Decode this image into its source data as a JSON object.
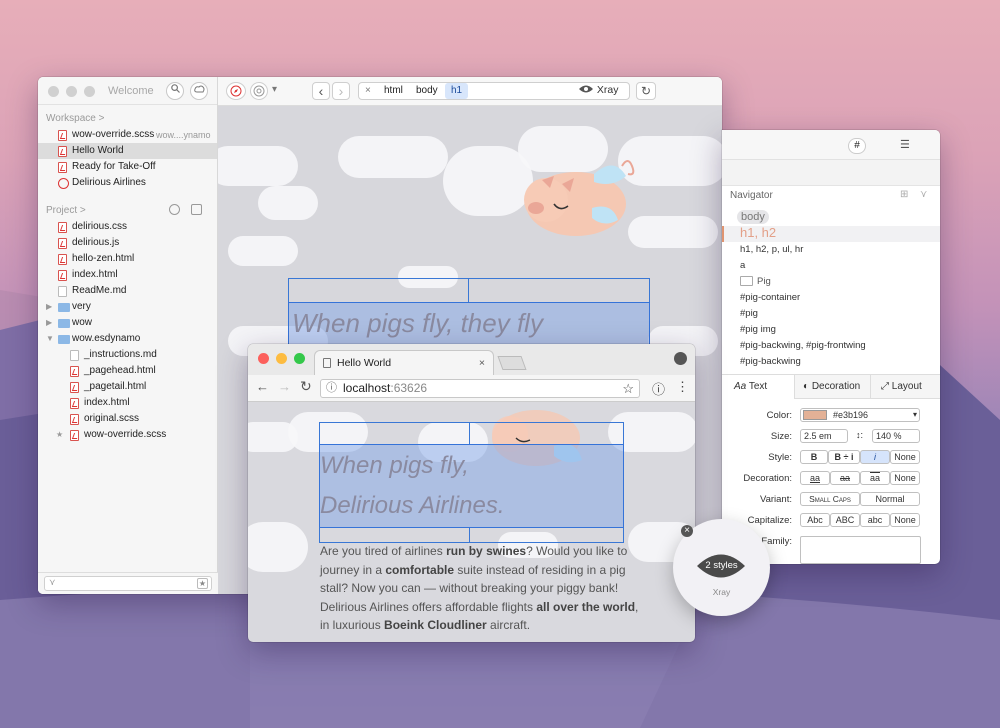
{
  "colors": {
    "accent": "#3977d5",
    "close": "#fc605c",
    "min": "#fdbc40",
    "max": "#34c84a",
    "pink": "#e3b196"
  },
  "sidebar": {
    "title": "Welcome",
    "workspace_label": "Workspace",
    "workspace_chevron": ">",
    "workspace": [
      {
        "label": "wow-override.scss",
        "sub": "wow....ynamo",
        "icon": "scss-file-icon"
      },
      {
        "label": "Hello World",
        "icon": "espresso-project-icon",
        "selected": true
      },
      {
        "label": "Ready for Take-Off",
        "icon": "espresso-project-icon"
      },
      {
        "label": "Delirious Airlines",
        "icon": "compass-icon"
      }
    ],
    "project_label": "Project",
    "project_chevron": ">",
    "project": [
      {
        "label": "delirious.css"
      },
      {
        "label": "delirious.js"
      },
      {
        "label": "hello-zen.html"
      },
      {
        "label": "index.html"
      },
      {
        "label": "ReadMe.md"
      },
      {
        "label": "very",
        "folder": true,
        "disc": "▶"
      },
      {
        "label": "wow",
        "folder": true,
        "disc": "▶"
      },
      {
        "label": "wow.esdynamo",
        "folder": true,
        "disc": "▼"
      },
      {
        "label": "_instructions.md",
        "indent": true
      },
      {
        "label": "_pagehead.html",
        "indent": true
      },
      {
        "label": "_pagetail.html",
        "indent": true
      },
      {
        "label": "index.html",
        "indent": true
      },
      {
        "label": "original.scss",
        "indent": true
      },
      {
        "label": "wow-override.scss",
        "indent": true,
        "star": "★"
      }
    ]
  },
  "toolbar": {
    "crumbs": [
      "html",
      "body",
      "h1"
    ],
    "close": "×",
    "back": "‹",
    "fwd": "›",
    "xray": "Xray",
    "reload": "↻",
    "menu": "▾"
  },
  "preview": {
    "heading": "When pigs fly, they fly"
  },
  "inspector": {
    "hash": "#",
    "navigator": "Navigator",
    "nav_items": [
      "body",
      "h1, h2",
      "h1, h2, p, ul, hr",
      "a",
      "Pig",
      "#pig-container",
      "#pig",
      "#pig img",
      "#pig-backwing, #pig-frontwing",
      "#pig-backwing"
    ],
    "tabs": [
      "Text",
      "Decoration",
      "Layout"
    ],
    "tab_icons": [
      "Aa",
      "◐",
      "⤢"
    ],
    "props": {
      "color_label": "Color:",
      "color_value": "#e3b196",
      "size_label": "Size:",
      "size_value": "2.5 em",
      "line_value": "140 %",
      "style_label": "Style:",
      "style_opts": [
        "B",
        "B ÷ i",
        "i",
        "None"
      ],
      "decoration_label": "Decoration:",
      "decoration_opts": [
        "aa",
        "aa",
        "aa",
        "None"
      ],
      "variant_label": "Variant:",
      "variant_opts": [
        "Small Caps",
        "Normal"
      ],
      "capitalize_label": "Capitalize:",
      "capitalize_opts": [
        "Abc",
        "ABC",
        "abc",
        "None"
      ],
      "family_label": "Family:"
    }
  },
  "chrome": {
    "tab_title": "Hello World",
    "tab_close": "×",
    "url_host": "localhost",
    "url_port": ":63626",
    "nav_back": "←",
    "nav_fwd": "→",
    "nav_reload": "↻",
    "info": "ⓘ",
    "star": "☆",
    "info_btn": "ⓘ",
    "more": "⋮",
    "h1_line1": "When pigs fly,",
    "h1_line2": "Delirious Airlines.",
    "para": {
      "t1": "Are you tired of airlines ",
      "b1": "run by swines",
      "t2": "? Would you like to journey in a ",
      "b2": "comfortable",
      "t3": " suite instead of residing in a pig stall? Now you can — without breaking your piggy bank! Delirious Airlines offers affordable flights ",
      "b3": "all over the world",
      "t4": ", in luxurious ",
      "b4": "Boeink Cloudliner",
      "t5": " aircraft."
    }
  },
  "xray_badge": {
    "styles": "2 styles",
    "label": "Xray",
    "close": "×"
  }
}
